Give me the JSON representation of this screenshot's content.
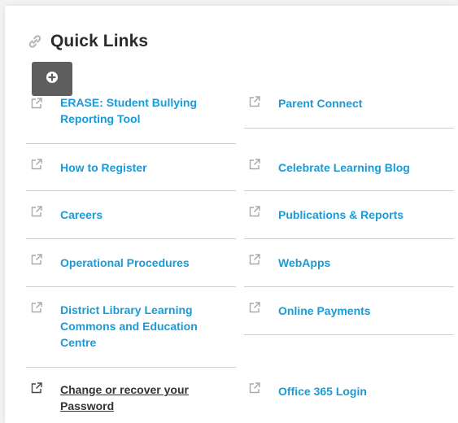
{
  "title": "Quick Links",
  "colors": {
    "link": "#1a9ad6",
    "dark_link": "#333333",
    "button_bg": "#5e5e5e"
  },
  "left_links": [
    {
      "label": "ERASE: Student Bullying Reporting Tool",
      "icon": "external-link-icon"
    },
    {
      "label": "How to Register",
      "icon": "external-link-icon"
    },
    {
      "label": "Careers",
      "icon": "external-link-icon"
    },
    {
      "label": "Operational Procedures",
      "icon": "external-link-icon"
    },
    {
      "label": "District Library Learning Commons and Education Centre",
      "icon": "external-link-icon"
    },
    {
      "label": "Change or recover your Password",
      "icon": "external-link-icon"
    }
  ],
  "right_links": [
    {
      "label": "Parent Connect",
      "icon": "external-link-icon"
    },
    {
      "label": "Celebrate Learning Blog",
      "icon": "external-link-icon"
    },
    {
      "label": "Publications & Reports",
      "icon": "external-link-icon"
    },
    {
      "label": "WebApps",
      "icon": "external-link-icon"
    },
    {
      "label": "Online Payments",
      "icon": "external-link-icon"
    },
    {
      "label": "Office 365 Login",
      "icon": "external-link-icon"
    }
  ]
}
